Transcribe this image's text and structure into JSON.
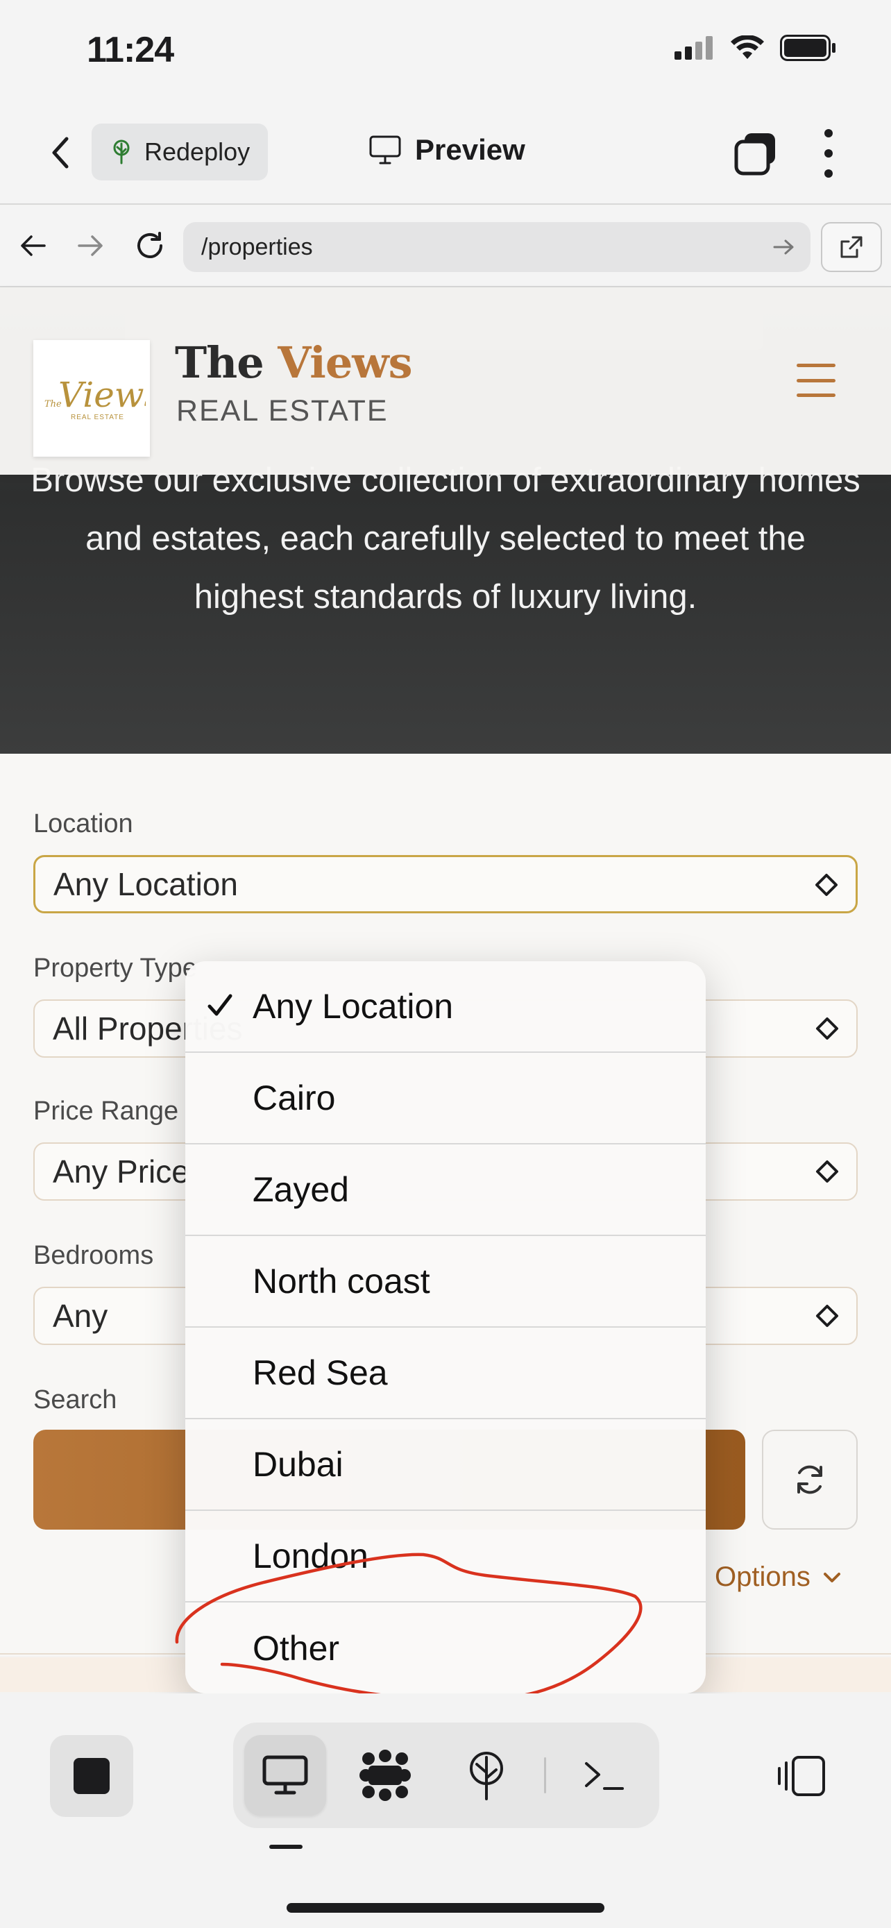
{
  "status_bar": {
    "time": "11:24"
  },
  "toolbar": {
    "redeploy_label": "Redeploy",
    "preview_label": "Preview"
  },
  "browser": {
    "url": "/properties"
  },
  "site": {
    "brand_first": "The ",
    "brand_accent": "Views",
    "brand_sub": "REAL ESTATE",
    "logo_script": "Views",
    "logo_small": "The",
    "logo_caption": "REAL ESTATE",
    "accent_color": "#b8763a"
  },
  "hero": {
    "description": "Browse our exclusive collection of extraordinary homes and estates, each carefully selected to meet the highest standards of luxury living."
  },
  "filters": {
    "location_label": "Location",
    "location_value": "Any Location",
    "type_label": "Property Type",
    "type_value": "All Properties",
    "price_label": "Price Range",
    "price_value": "Any Price",
    "bedrooms_label": "Bedrooms",
    "bedrooms_value": "Any",
    "search_label": "Search",
    "options_label": "Options"
  },
  "location_dropdown": {
    "selected": "Any Location",
    "options": [
      "Any Location",
      "Cairo",
      "Zayed",
      "North coast",
      "Red Sea",
      "Dubai",
      "London",
      "Other"
    ],
    "annotation_color": "#d9321e"
  },
  "icons": {
    "back": "chevron-left-icon",
    "redeploy": "tree-icon",
    "preview": "monitor-icon",
    "tabs": "tabs-icon",
    "more": "more-vertical-icon",
    "reload": "reload-icon",
    "external": "external-link-icon",
    "menu": "hamburger-icon",
    "select": "updown-chevron-icon",
    "reset": "refresh-icon",
    "stop": "stop-icon",
    "preview_tool": "desktop-icon",
    "apps": "apps-icon",
    "deploy": "deploy-icon",
    "terminal": "terminal-icon",
    "panel": "side-panel-icon"
  }
}
